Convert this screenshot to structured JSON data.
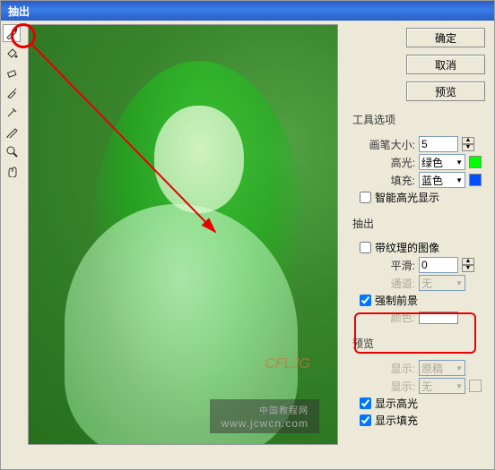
{
  "titlebar": "抽出",
  "buttons": {
    "ok": "确定",
    "cancel": "取消",
    "preview": "预览"
  },
  "toolOptions": {
    "title": "工具选项",
    "brushSizeLabel": "画笔大小:",
    "brushSize": "5",
    "highlightLabel": "高光:",
    "highlight": "绿色",
    "fillLabel": "填充:",
    "fill": "蓝色",
    "smartHighlight": "智能高光显示"
  },
  "extract": {
    "title": "抽出",
    "texturedLabel": "带纹理的图像",
    "smoothLabel": "平滑:",
    "smooth": "0",
    "channelLabel": "通道:",
    "channel": "无",
    "forceFgLabel": "强制前景",
    "colorLabel": "颜色:"
  },
  "previewSection": {
    "title": "预览",
    "showLabel": "显示:",
    "show": "原稿",
    "displayLabel": "显示:",
    "display": "无",
    "showHighlight": "显示高光",
    "showFill": "显示填充"
  },
  "watermark": {
    "brand": "CFLJG",
    "siteCn": "中国教程网",
    "url": "www.jcwcn.com"
  },
  "tools": [
    "edge-highlighter",
    "fill",
    "eraser",
    "eyedropper",
    "cleanup",
    "edge-touchup",
    "zoom",
    "hand"
  ]
}
